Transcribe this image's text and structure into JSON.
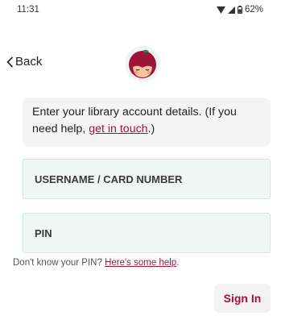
{
  "status_bar": {
    "time": "11:31",
    "battery": "62%"
  },
  "header": {
    "back_label": "Back",
    "logo_icon": "libby-logo-icon"
  },
  "info": {
    "text_before": "Enter your library account details. (If you need help, ",
    "link": "get in touch",
    "text_after": ".)"
  },
  "form": {
    "username_placeholder": "USERNAME / CARD NUMBER",
    "pin_placeholder": "PIN",
    "pin_help_text": "Don't know your PIN? ",
    "pin_help_link": "Here's some help",
    "pin_help_suffix": ".",
    "sign_in_label": "Sign In"
  },
  "colors": {
    "accent": "#a4133c",
    "field_bg": "#eff7f4",
    "info_bg": "#f4f4f4"
  }
}
